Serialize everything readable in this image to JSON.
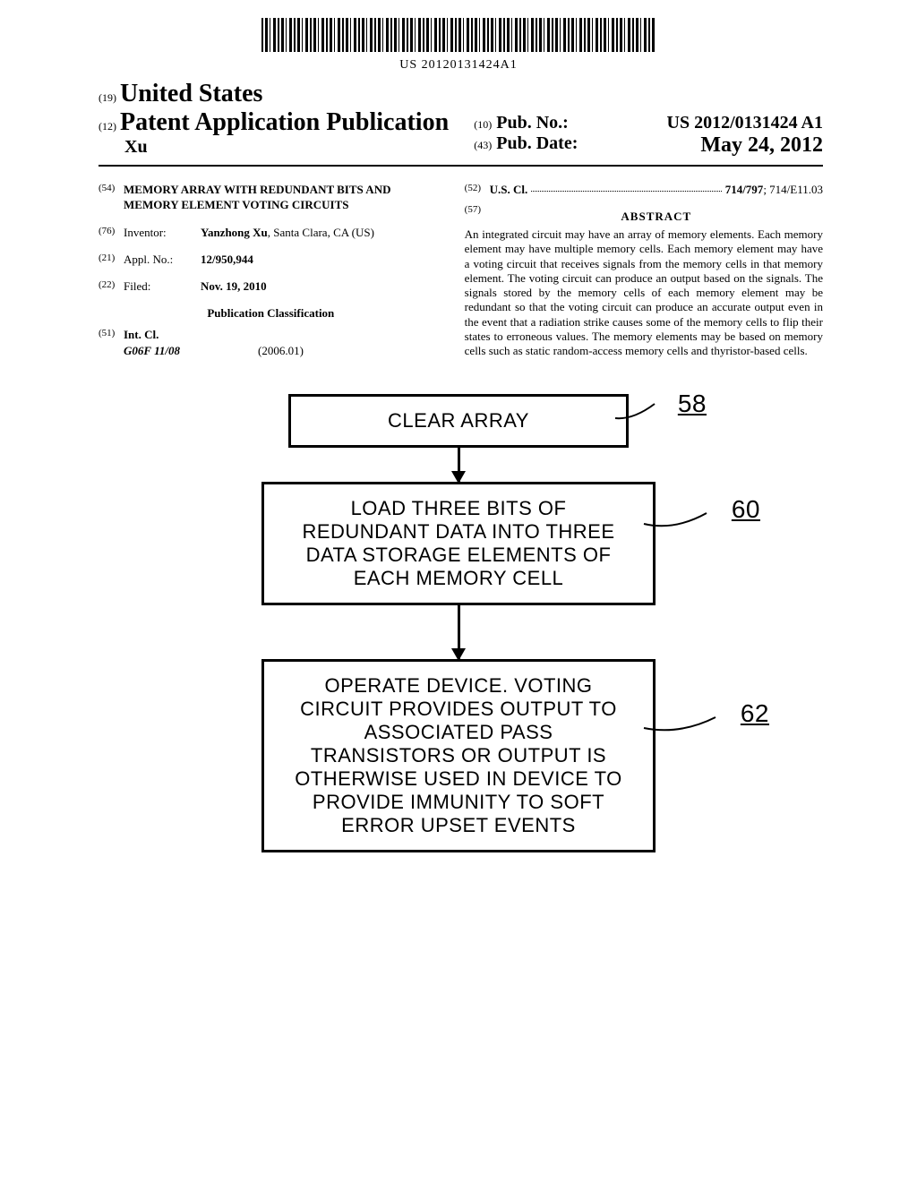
{
  "barcode_number": "US 20120131424A1",
  "header": {
    "country_code": "(19)",
    "country": "United States",
    "pub_type_code": "(12)",
    "pub_type": "Patent Application Publication",
    "author": "Xu",
    "pub_no_code": "(10)",
    "pub_no_label": "Pub. No.:",
    "pub_no_value": "US 2012/0131424 A1",
    "pub_date_code": "(43)",
    "pub_date_label": "Pub. Date:",
    "pub_date_value": "May 24, 2012"
  },
  "left_col": {
    "title_code": "(54)",
    "title": "MEMORY ARRAY WITH REDUNDANT BITS AND MEMORY ELEMENT VOTING CIRCUITS",
    "inventor_code": "(76)",
    "inventor_label": "Inventor:",
    "inventor_value_bold": "Yanzhong Xu",
    "inventor_value_rest": ", Santa Clara, CA (US)",
    "appl_code": "(21)",
    "appl_label": "Appl. No.:",
    "appl_value": "12/950,944",
    "filed_code": "(22)",
    "filed_label": "Filed:",
    "filed_value": "Nov. 19, 2010",
    "pub_class_heading": "Publication Classification",
    "intcl_code": "(51)",
    "intcl_label": "Int. Cl.",
    "intcl_value": "G06F 11/08",
    "intcl_year": "(2006.01)"
  },
  "right_col": {
    "uscl_code": "(52)",
    "uscl_label": "U.S. Cl.",
    "uscl_value_bold": "714/797",
    "uscl_value_rest": "; 714/E11.03",
    "abstract_code": "(57)",
    "abstract_heading": "ABSTRACT",
    "abstract_text": "An integrated circuit may have an array of memory elements. Each memory element may have multiple memory cells. Each memory element may have a voting circuit that receives signals from the memory cells in that memory element. The voting circuit can produce an output based on the signals. The signals stored by the memory cells of each memory element may be redundant so that the voting circuit can produce an accurate output even in the event that a radiation strike causes some of the memory cells to flip their states to erroneous values. The memory elements may be based on memory cells such as static random-access memory cells and thyristor-based cells."
  },
  "diagram": {
    "box1": "CLEAR ARRAY",
    "box2": "LOAD THREE BITS OF REDUNDANT DATA INTO THREE DATA STORAGE ELEMENTS OF EACH MEMORY CELL",
    "box3": "OPERATE DEVICE. VOTING CIRCUIT PROVIDES OUTPUT TO ASSOCIATED PASS TRANSISTORS OR OUTPUT IS OTHERWISE USED IN DEVICE TO PROVIDE IMMUNITY TO SOFT ERROR UPSET EVENTS",
    "ref58": "58",
    "ref60": "60",
    "ref62": "62"
  }
}
